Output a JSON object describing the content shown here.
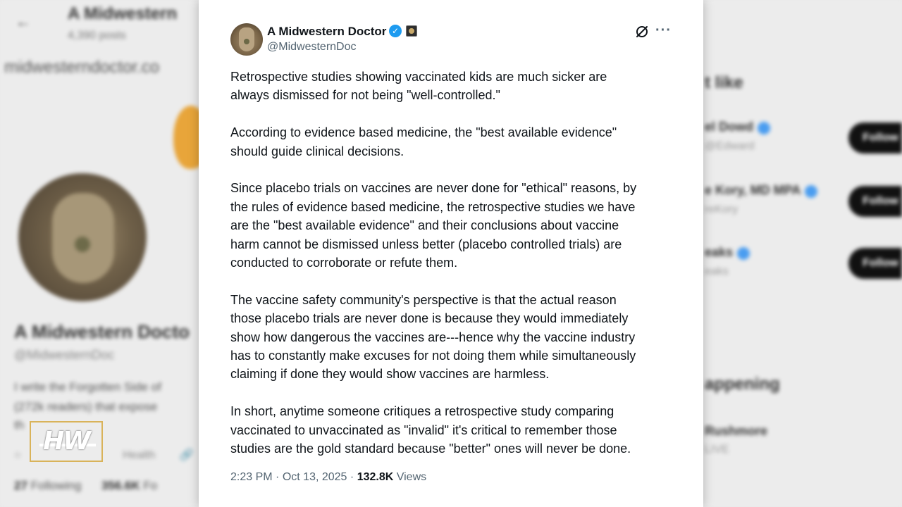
{
  "background": {
    "header_name": "A Midwestern",
    "header_posts": "4,390 posts",
    "url": "midwesterndoctor.co",
    "profile_name": "A Midwestern Docto",
    "profile_handle": "@MidwesternDoc",
    "bio_lines": [
      "I write the Forgotten Side of",
      "(272k readers) that expose",
      "th"
    ],
    "meta": "Health",
    "following_count": "27",
    "following_label": "Following",
    "followers_count": "356.6K",
    "followers_label": "Fo",
    "you_might_like": "t like",
    "suggestions": [
      {
        "name": "el Dowd",
        "handle": "@Edward"
      },
      {
        "name": "e Kory, MD MPA",
        "handle": "reKory"
      },
      {
        "name": "eaks",
        "handle": "eaks"
      }
    ],
    "follow_label": "Follow",
    "happening": "appening",
    "trend_title": "Rushmore",
    "trend_sub": "LIVE"
  },
  "watermark": {
    "text": "HW"
  },
  "tweet": {
    "author_name": "A Midwestern Doctor",
    "author_handle": "@MidwesternDoc",
    "paragraphs": [
      "Retrospective studies showing vaccinated kids are much sicker are\nalways dismissed for not being \"well-controlled.\"",
      "According to evidence based medicine, the \"best available evidence\"\nshould guide clinical decisions.",
      "Since placebo trials on vaccines are never done for \"ethical\" reasons, by\nthe rules of evidence based medicine, the retrospective studies we have\nare the  \"best available evidence\" and their conclusions about vaccine\nharm cannot be dismissed unless better (placebo controlled trials) are\nconducted to corroborate or refute them.",
      "The vaccine safety community's perspective is that the actual reason\nthose placebo trials are never done is because they would immediately\nshow how dangerous the vaccines are---hence why the vaccine industry\nhas to constantly make excuses for not doing them while simultaneously\nclaiming if done they would show vaccines are harmless.",
      "In short, anytime someone critiques a retrospective study comparing\nvaccinated to unvaccinated as \"invalid\" it's critical to remember those\nstudies are the gold standard because \"better\" ones will never be done."
    ],
    "time": "2:23 PM",
    "separator": "·",
    "date": "Oct 13, 2025",
    "views_count": "132.8K",
    "views_label": "Views",
    "icons": {
      "verified": "verified-badge-icon",
      "grok": "grok-icon",
      "more": "more-icon"
    },
    "colors": {
      "verified": "#1d9bf0",
      "secondary_text": "#536471",
      "primary_text": "#0f1419"
    }
  }
}
